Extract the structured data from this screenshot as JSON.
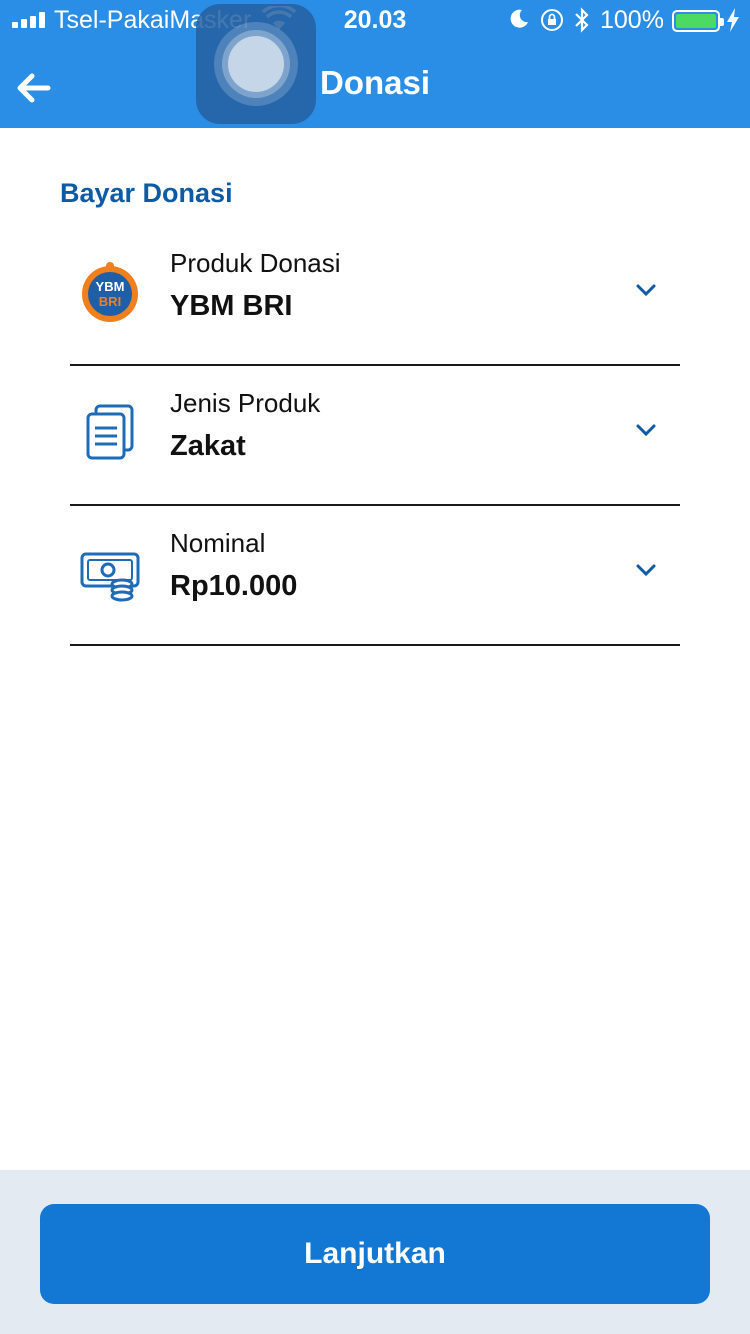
{
  "status_bar": {
    "carrier": "Tsel-PakaiMasker",
    "time": "20.03",
    "battery_percent": "100%"
  },
  "header": {
    "title": "Donasi"
  },
  "section": {
    "title": "Bayar Donasi"
  },
  "fields": [
    {
      "label": "Produk Donasi",
      "value": "YBM BRI",
      "icon": "ybm-bri-logo"
    },
    {
      "label": "Jenis Produk",
      "value": "Zakat",
      "icon": "document-icon"
    },
    {
      "label": "Nominal",
      "value": "Rp10.000",
      "icon": "money-icon"
    }
  ],
  "logo_text": {
    "line1": "YBM",
    "line2": "BRI"
  },
  "footer": {
    "button_label": "Lanjutkan"
  },
  "colors": {
    "header_bg": "#2a8ee6",
    "accent": "#0d5aa6",
    "button": "#1278d4",
    "footer_bg": "#e4eaf1",
    "logo_orange": "#f07f1e"
  }
}
